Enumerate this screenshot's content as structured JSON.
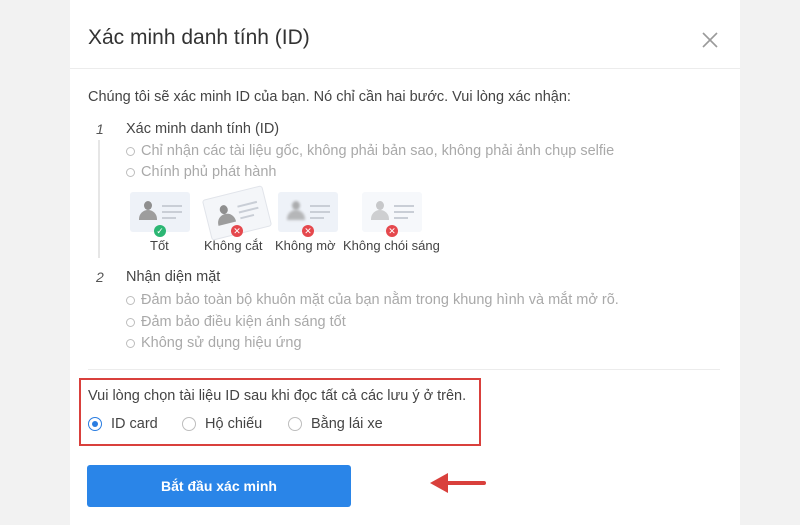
{
  "dialog": {
    "title": "Xác minh danh tính (ID)",
    "intro": "Chúng tôi sẽ xác minh ID của bạn. Nó chỉ cần hai bước. Vui lòng xác nhận:"
  },
  "steps": [
    {
      "number": "1",
      "title": "Xác minh danh tính (ID)",
      "notes": [
        "Chỉ nhận các tài liệu gốc, không phải bản sao, không phải ảnh chụp selfie",
        "Chính phủ phát hành"
      ],
      "examples": [
        {
          "label": "Tốt",
          "status": "ok",
          "status_icon": "check-icon"
        },
        {
          "label": "Không cắt",
          "status": "bad",
          "status_icon": "x-icon"
        },
        {
          "label": "Không mờ",
          "status": "bad",
          "status_icon": "x-icon"
        },
        {
          "label": "Không chói sáng",
          "status": "bad",
          "status_icon": "x-icon"
        }
      ]
    },
    {
      "number": "2",
      "title": "Nhận diện mặt",
      "notes": [
        "Đảm bảo toàn bộ khuôn mặt của bạn nằm trong khung hình và mắt mở rõ.",
        "Đảm bảo điều kiện ánh sáng tốt",
        "Không sử dụng hiệu ứng"
      ]
    }
  ],
  "document_select": {
    "label": "Vui lòng chọn tài liệu ID sau khi đọc tất cả các lưu ý ở trên.",
    "options": [
      {
        "label": "ID card",
        "checked": true
      },
      {
        "label": "Hộ chiếu",
        "checked": false
      },
      {
        "label": "Bằng lái xe",
        "checked": false
      }
    ]
  },
  "actions": {
    "start_label": "Bắt đầu xác minh"
  },
  "colors": {
    "accent": "#2a85e8",
    "highlight": "#d9403c",
    "ok": "#2bb673",
    "bad": "#e5484d"
  }
}
